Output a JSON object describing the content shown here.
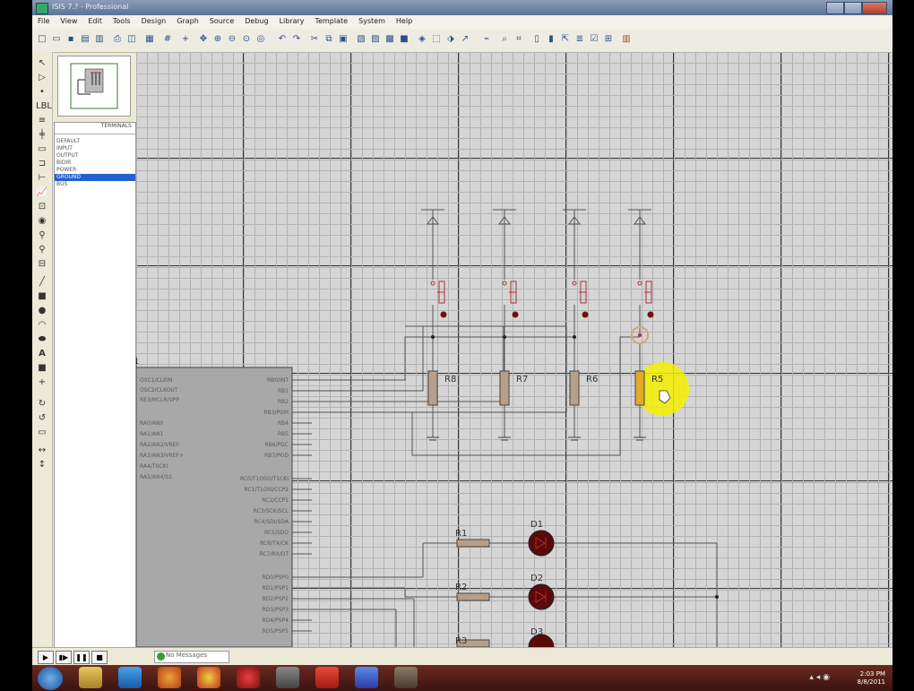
{
  "window": {
    "title": "ISIS 7.? - Professional"
  },
  "menu": [
    "File",
    "View",
    "Edit",
    "Tools",
    "Design",
    "Graph",
    "Source",
    "Debug",
    "Library",
    "Template",
    "System",
    "Help"
  ],
  "device_panel": {
    "header": "TERMINALS",
    "items": [
      "DEFAULT",
      "INPUT",
      "OUTPUT",
      "BIDIR",
      "POWER",
      "GROUND",
      "BUS"
    ],
    "selected_index": 5
  },
  "schematic": {
    "resistor_labels": [
      "R8",
      "R7",
      "R6",
      "R5"
    ],
    "bottom_resistors": [
      "R1",
      "R2",
      "R3"
    ],
    "leds": [
      "D1",
      "D2",
      "D3"
    ],
    "ic_left_pins": [
      "OSC1/CLKIN",
      "OSC2/CLKOUT",
      "RE3/MCLR/VPP",
      "RA0/AN0",
      "RA1/AN1",
      "RA2/AN2/VREF-",
      "RA3/AN3/VREF+",
      "RA4/T0CKI",
      "RA5/AN4/SS"
    ],
    "ic_right_pins": [
      "RB0/INT",
      "RB1",
      "RB2",
      "RB3/PGM",
      "RB4",
      "RB5",
      "RB6/PGC",
      "RB7/PGD",
      "RC0/T1OSO/T1CKI",
      "RC1/T1OSI/CCP2",
      "RC2/CCP1",
      "RC3/SCK/SCL",
      "RC4/SDI/SDA",
      "RC5/SDO",
      "RC6/TX/CK",
      "RC7/RX/DT",
      "RD0/PSP0",
      "RD1/PSP1",
      "RD2/PSP2",
      "RD3/PSP3",
      "RD4/PSP4",
      "RD5/PSP5"
    ]
  },
  "statusbar": {
    "message": "No Messages"
  },
  "taskbar": {
    "time": "2:03 PM",
    "date": "8/8/2011"
  }
}
